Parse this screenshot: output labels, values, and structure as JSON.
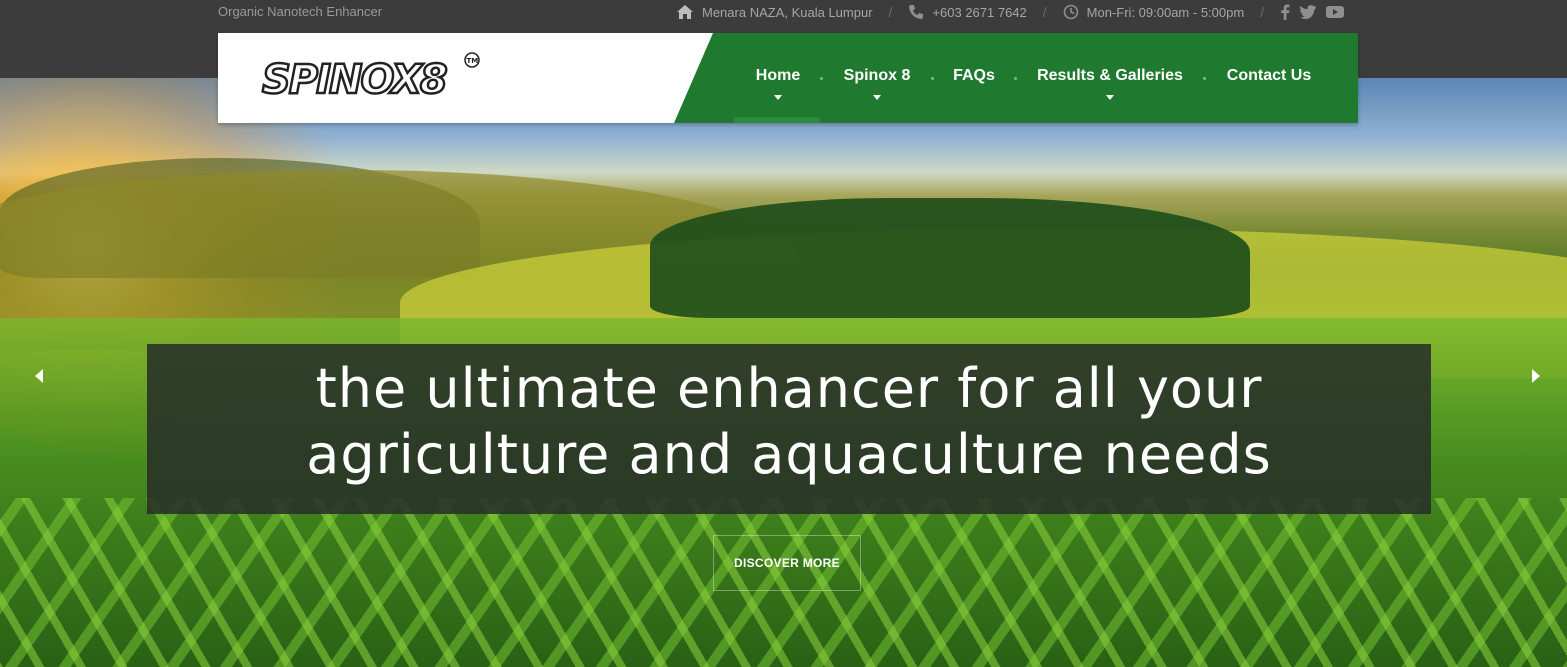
{
  "topbar": {
    "tagline": "Organic Nanotech Enhancer",
    "address": "Menara NAZA, Kuala Lumpur",
    "phone": "+603 2671 7642",
    "hours": "Mon-Fri: 09:00am - 5:00pm",
    "icons": [
      "home-icon",
      "phone-icon",
      "clock-icon",
      "facebook-icon",
      "twitter-icon",
      "youtube-icon"
    ]
  },
  "logo": {
    "text": "SPINOX8",
    "trademark": "TM"
  },
  "nav": {
    "items": [
      {
        "label": "Home",
        "has_dropdown": true,
        "active": true
      },
      {
        "label": "Spinox 8",
        "has_dropdown": true
      },
      {
        "label": "FAQs",
        "has_dropdown": false
      },
      {
        "label": "Results & Galleries",
        "has_dropdown": true
      },
      {
        "label": "Contact Us",
        "has_dropdown": false
      }
    ]
  },
  "hero": {
    "headline_line1": "the ultimate enhancer for all your",
    "headline_line2": "agriculture and aquaculture needs",
    "cta_label": "DISCOVER MORE"
  },
  "colors": {
    "topbar": "#3c3c3c",
    "nav_green": "#1f7a2f",
    "caption_bg": "#283028"
  }
}
